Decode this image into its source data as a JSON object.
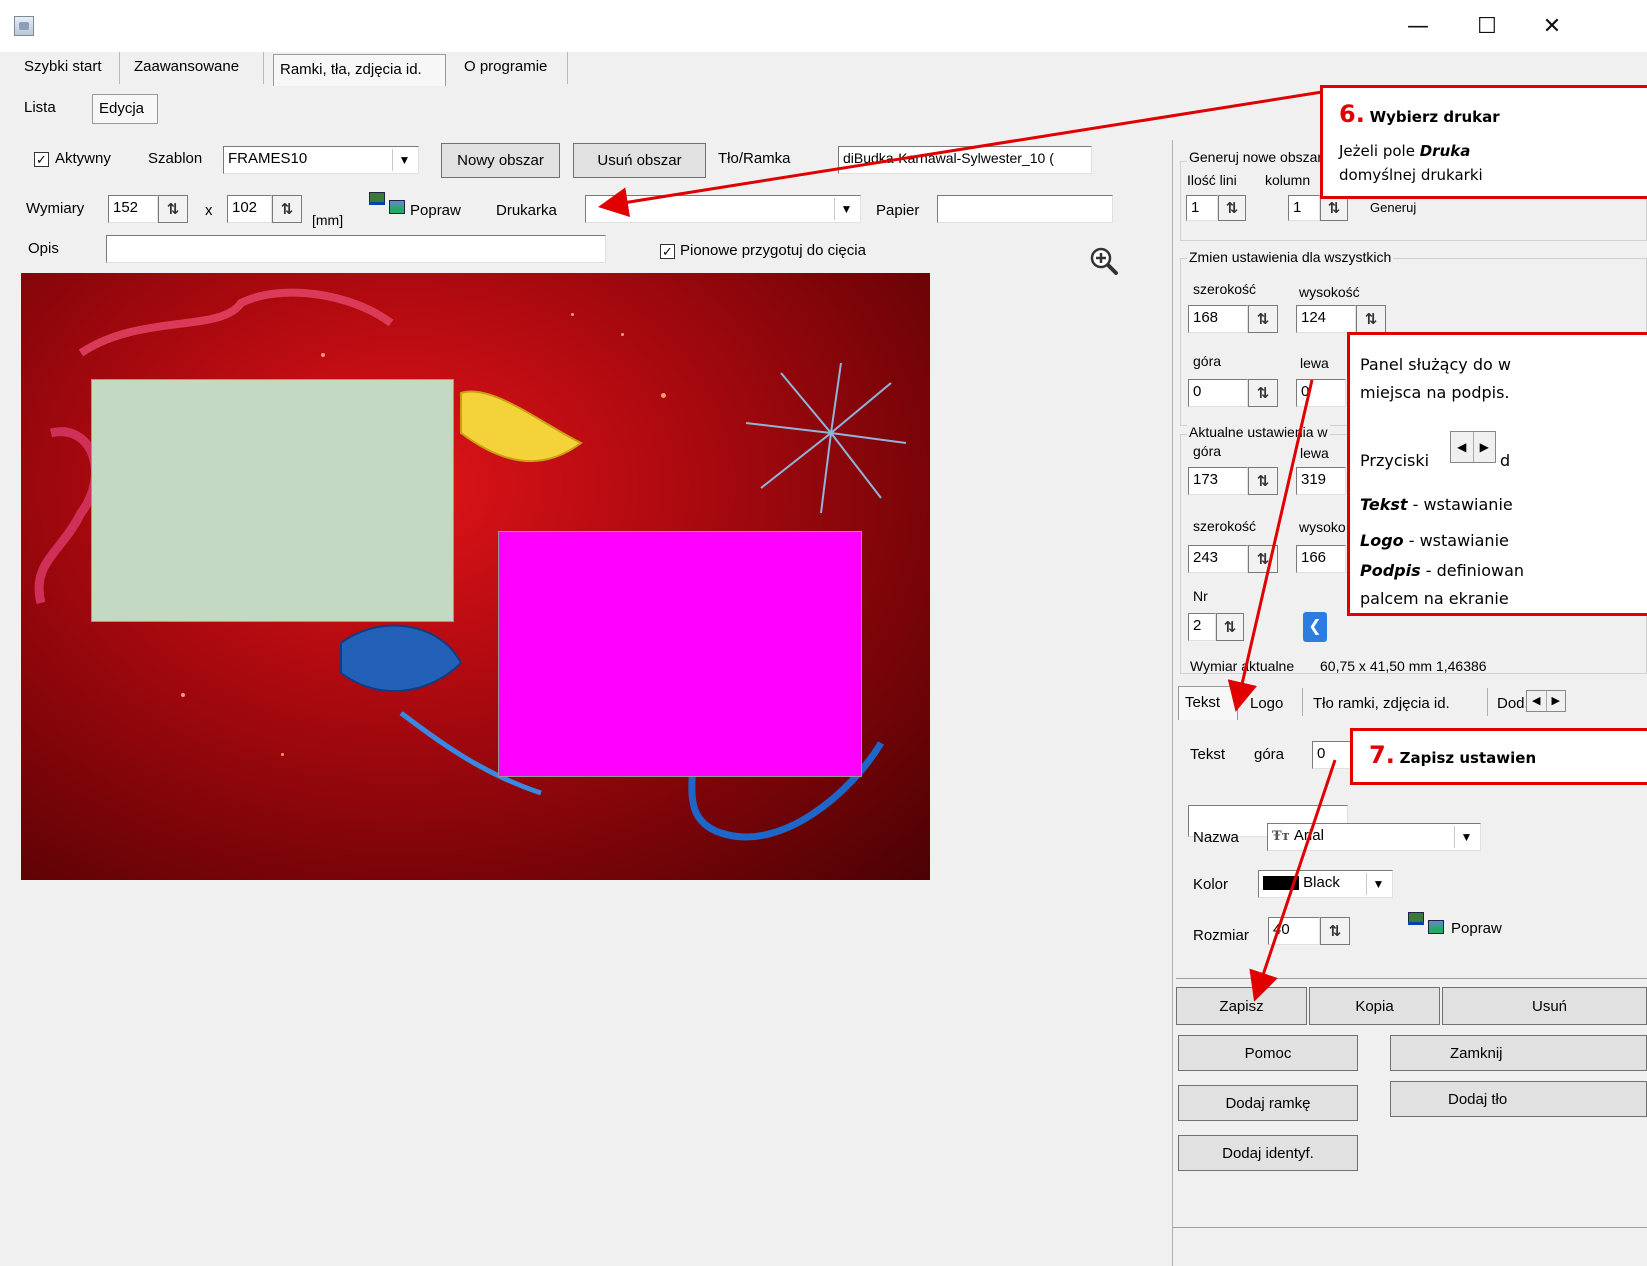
{
  "tabs": [
    "Szybki start",
    "Zaawansowane",
    "Ramki, tła, zdjęcia id.",
    "O programie"
  ],
  "subtabs": [
    "Lista",
    "Edycja"
  ],
  "row1": {
    "aktywny_label": "Aktywny",
    "szablon_label": "Szablon",
    "szablon_value": "FRAMES10",
    "nowy_obszar": "Nowy obszar",
    "usun_obszar": "Usuń obszar",
    "tlo_label": "Tło/Ramka",
    "tlo_value": "diBudka-Karnawal-Sylwester_10 ("
  },
  "row2": {
    "wymiary_label": "Wymiary",
    "width": "152",
    "x": "x",
    "height": "102",
    "unit": "[mm]",
    "popraw": "Popraw",
    "drukarka_label": "Drukarka",
    "drukarka_value": "",
    "papier_label": "Papier",
    "papier_value": ""
  },
  "row3": {
    "opis_label": "Opis",
    "opis_value": "",
    "pionowe_label": "Pionowe przygotuj do cięcia"
  },
  "canvas_colors": {
    "area1": "#c3d9c1",
    "area2": "#ff00ff"
  },
  "panel": {
    "generuj_title": "Generuj nowe obszary",
    "ilosc_lini": "Ilość lini",
    "kolumn": "kolumn",
    "lini_value": "1",
    "kolumn_value": "1",
    "generuj_btn": "Generuj",
    "zmien_title": "Zmien ustawienia dla wszystkich",
    "szerokosc": "szerokość",
    "wysokosc": "wysokość",
    "szer_value": "168",
    "wys_value": "124",
    "gora": "góra",
    "lewa": "lewa",
    "gora_value": "0",
    "lewa_value": "0",
    "aktualne_title": "Aktualne ustawienia w",
    "akt_gora_value": "173",
    "akt_lewa_value": "319",
    "akt_szer_value": "243",
    "akt_wys_value": "166",
    "wysoko": "wysoko",
    "nr": "Nr",
    "nr_value": "2",
    "wymiar_aktualne": "Wymiar aktualne",
    "wymiar_value": "60,75 x 41,50 mm 1,46386"
  },
  "bottom_tabs": [
    "Tekst",
    "Logo",
    "Tło ramki, zdjęcia id.",
    "Dod.zo"
  ],
  "text_panel": {
    "tekst": "Tekst",
    "gora": "góra",
    "gora_value": "0",
    "nazwa": "Nazwa",
    "font_value": "Arial",
    "kolor": "Kolor",
    "kolor_value": "Black",
    "rozmiar": "Rozmiar",
    "rozmiar_value": "40",
    "popraw": "Popraw"
  },
  "buttons": {
    "zapisz": "Zapisz",
    "kopia": "Kopia",
    "usun": "Usuń",
    "pomoc": "Pomoc",
    "zamknij": "Zamknij",
    "dodaj_ramke": "Dodaj ramkę",
    "dodaj_tlo": "Dodaj tło",
    "dodaj_identyf": "Dodaj identyf."
  },
  "callouts": {
    "c6_num": "6.",
    "c6_title": "Wybierz drukar",
    "c6_line1_a": "Jeżeli pole ",
    "c6_line1_b": "Druka",
    "c6_line2": "domyślnej drukarki",
    "panel_line1": "Panel służący do w",
    "panel_line2": "miejsca na podpis.",
    "przyciski": "Przyciski",
    "przyciski_tail": "d",
    "tekst_b": "Tekst",
    "tekst_rest": " - wstawianie",
    "logo_b": "Logo",
    "logo_rest": " - wstawianie",
    "podpis_b": "Podpis",
    "podpis_rest": " - definiowan",
    "palcem": "palcem na ekranie",
    "c7_num": "7.",
    "c7_title": "Zapisz ustawien"
  },
  "accent_red": "#e00000"
}
